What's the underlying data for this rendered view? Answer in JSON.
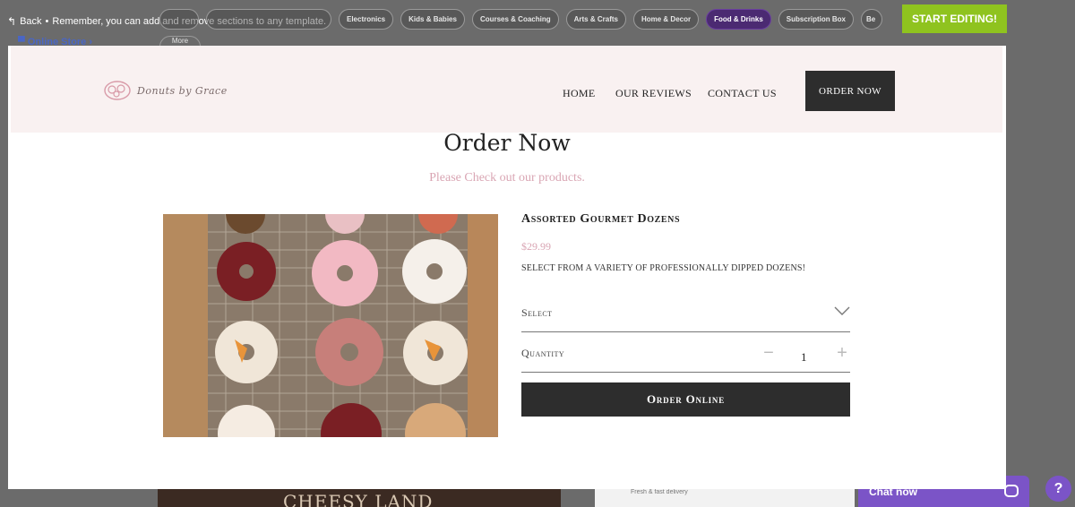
{
  "editor": {
    "back_label": "Back",
    "bullet": "•",
    "hint": "Remember, you can add and remove sections to any template.",
    "online_store": "Online Store",
    "online_store_chevron": "›",
    "more_label": "More",
    "start_editing": "START EDITING!",
    "categories": [
      {
        "label": "",
        "active": false,
        "style": "empty"
      },
      {
        "label": "",
        "active": false,
        "style": "empty"
      },
      {
        "label": "Electronics",
        "active": false
      },
      {
        "label": "Kids & Babies",
        "active": false
      },
      {
        "label": "Courses & Coaching",
        "active": false
      },
      {
        "label": "Arts & Crafts",
        "active": false
      },
      {
        "label": "Home & Decor",
        "active": false
      },
      {
        "label": "Food & Drinks",
        "active": true
      },
      {
        "label": "Subscription Box",
        "active": false
      },
      {
        "label": "Be",
        "active": false,
        "style": "trunc"
      }
    ],
    "background_banner": "CHEESY LAND",
    "background_card_text": "Fresh & fast delivery"
  },
  "chat": {
    "label": "Chat now",
    "help": "?"
  },
  "site": {
    "logo_text": "Donuts by Grace",
    "nav": {
      "home": "HOME",
      "reviews": "OUR REVIEWS",
      "contact": "CONTACT US"
    },
    "order_button": "ORDER NOW"
  },
  "page": {
    "title": "Order Now",
    "subtitle": "Please Check out our products."
  },
  "product": {
    "name": "Assorted Gourmet Dozens",
    "price": "$29.99",
    "description": "Select from a variety of professionally dipped dozens!",
    "select_label": "Select",
    "quantity_label": "Quantity",
    "quantity_value": "1",
    "minus": "−",
    "plus": "+",
    "order_button": "Order Online"
  },
  "colors": {
    "accent_pink": "#d9a5b3",
    "dark_button": "#2d2d2d",
    "start_green": "#8fc31f",
    "chat_purple": "#7b54c7",
    "active_pill": "#4b2a72"
  }
}
